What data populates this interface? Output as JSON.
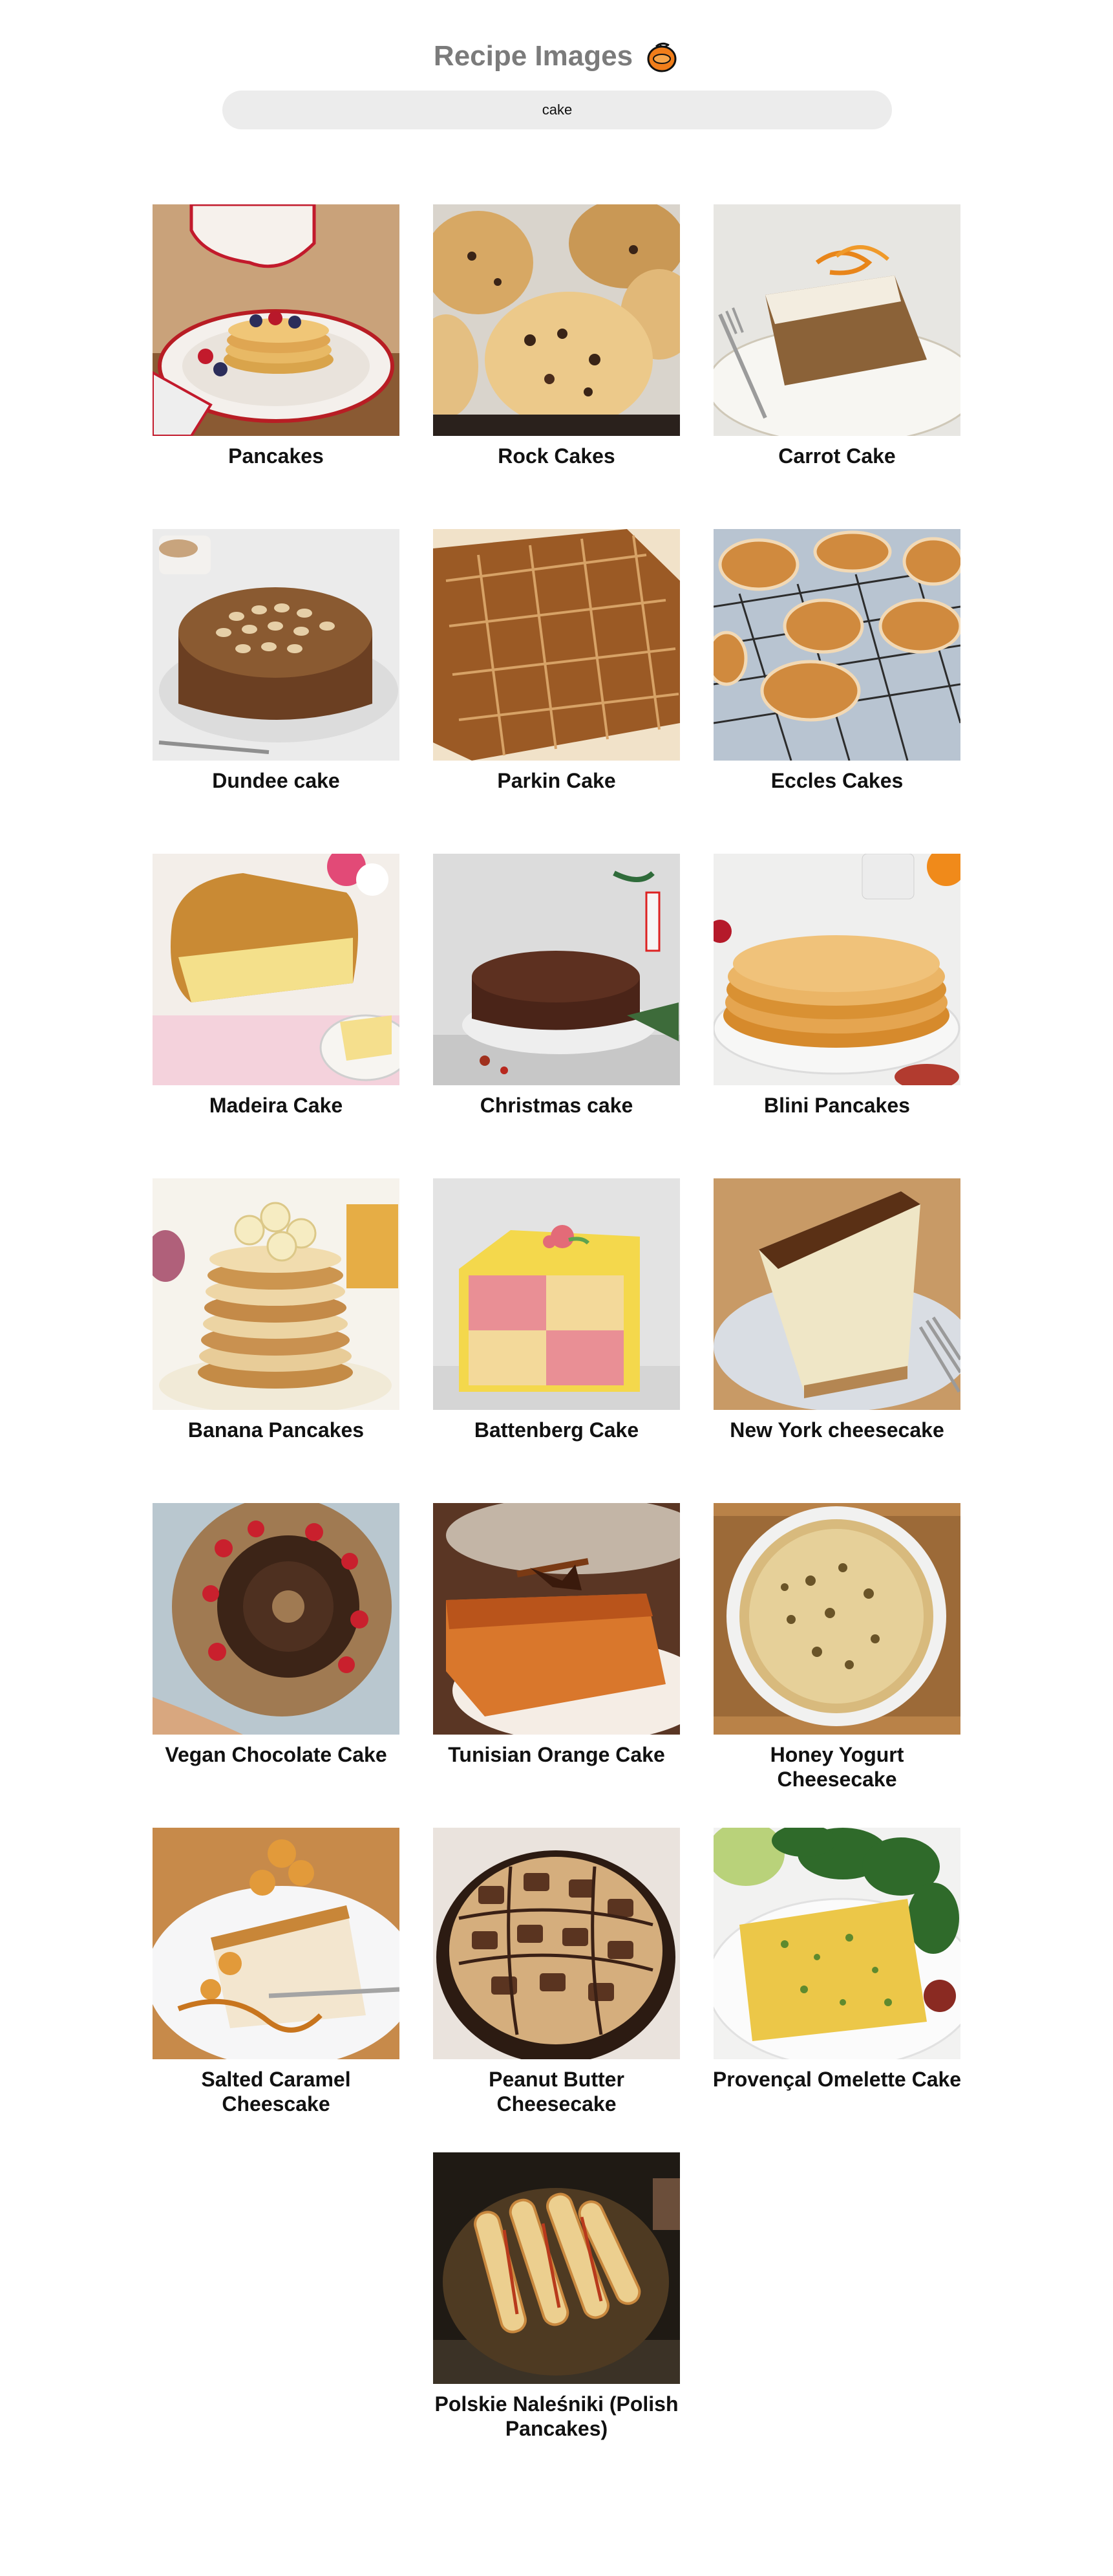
{
  "header": {
    "title": "Recipe Images",
    "logo_icon": "orange-fruit-icon",
    "logo_color": "#f07d1a"
  },
  "search": {
    "value": "cake",
    "placeholder": ""
  },
  "recipes": [
    {
      "title": "Pancakes",
      "image_icon": "pancakes-photo"
    },
    {
      "title": "Rock Cakes",
      "image_icon": "rock-cakes-photo"
    },
    {
      "title": "Carrot Cake",
      "image_icon": "carrot-cake-photo"
    },
    {
      "title": "Dundee cake",
      "image_icon": "dundee-cake-photo"
    },
    {
      "title": "Parkin Cake",
      "image_icon": "parkin-cake-photo"
    },
    {
      "title": "Eccles Cakes",
      "image_icon": "eccles-cakes-photo"
    },
    {
      "title": "Madeira Cake",
      "image_icon": "madeira-cake-photo"
    },
    {
      "title": "Christmas cake",
      "image_icon": "christmas-cake-photo"
    },
    {
      "title": "Blini Pancakes",
      "image_icon": "blini-pancakes-photo"
    },
    {
      "title": "Banana Pancakes",
      "image_icon": "banana-pancakes-photo"
    },
    {
      "title": "Battenberg Cake",
      "image_icon": "battenberg-cake-photo"
    },
    {
      "title": "New York cheesecake",
      "image_icon": "cheesecake-photo"
    },
    {
      "title": "Vegan Chocolate Cake",
      "image_icon": "chocolate-cake-photo"
    },
    {
      "title": "Tunisian Orange Cake",
      "image_icon": "orange-cake-photo"
    },
    {
      "title": "Honey Yogurt Cheesecake",
      "image_icon": "yogurt-cheesecake-photo"
    },
    {
      "title": "Salted Caramel Cheescake",
      "image_icon": "caramel-cheesecake-photo"
    },
    {
      "title": "Peanut Butter Cheesecake",
      "image_icon": "peanut-butter-cheesecake-photo"
    },
    {
      "title": "Provençal Omelette Cake",
      "image_icon": "omelette-cake-photo"
    },
    {
      "title": "Polskie Naleśniki (Polish Pancakes)",
      "image_icon": "polish-pancakes-photo"
    }
  ]
}
